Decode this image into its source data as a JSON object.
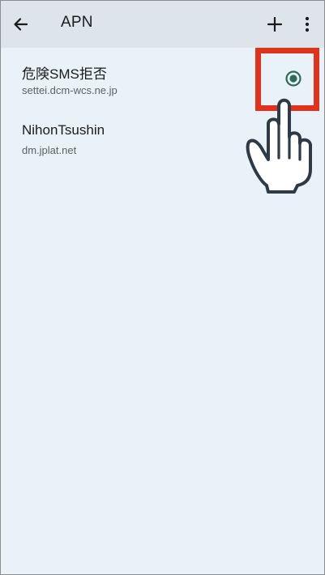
{
  "appbar": {
    "title": "APN",
    "back_icon": "arrow-left-icon",
    "add_icon": "plus-icon",
    "more_icon": "more-vert-icon"
  },
  "apn_list": [
    {
      "name": "危険SMS拒否",
      "apn": "settei.dcm-wcs.ne.jp",
      "selected": true
    },
    {
      "name": "NihonTsushin",
      "apn": "dm.jplat.net",
      "selected": false
    }
  ],
  "overlay": {
    "highlight_color": "#e1321c",
    "hand_icon": "pointing-hand-icon"
  },
  "colors": {
    "background": "#e8f2f8",
    "appbar": "#dde4ea",
    "radio_accent": "#2f6b57"
  }
}
